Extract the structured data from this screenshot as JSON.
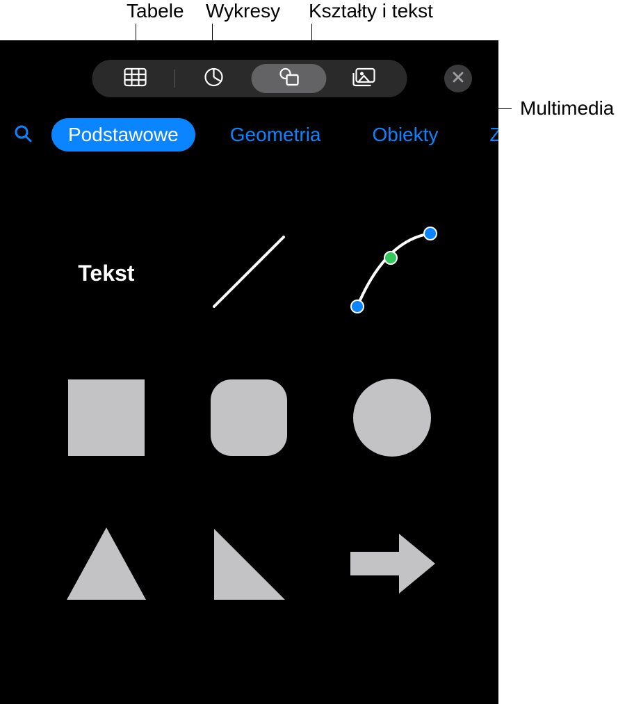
{
  "callouts": {
    "tables": "Tabele",
    "charts": "Wykresy",
    "shapes_text": "Kształty i tekst",
    "media": "Multimedia"
  },
  "categories": {
    "basic": "Podstawowe",
    "geometry": "Geometria",
    "objects": "Obiekty",
    "animals": "Zwierz"
  },
  "shapes": {
    "text_label": "Tekst"
  },
  "colors": {
    "accent": "#0a84ff",
    "shape_fill": "#c3c3c6"
  }
}
